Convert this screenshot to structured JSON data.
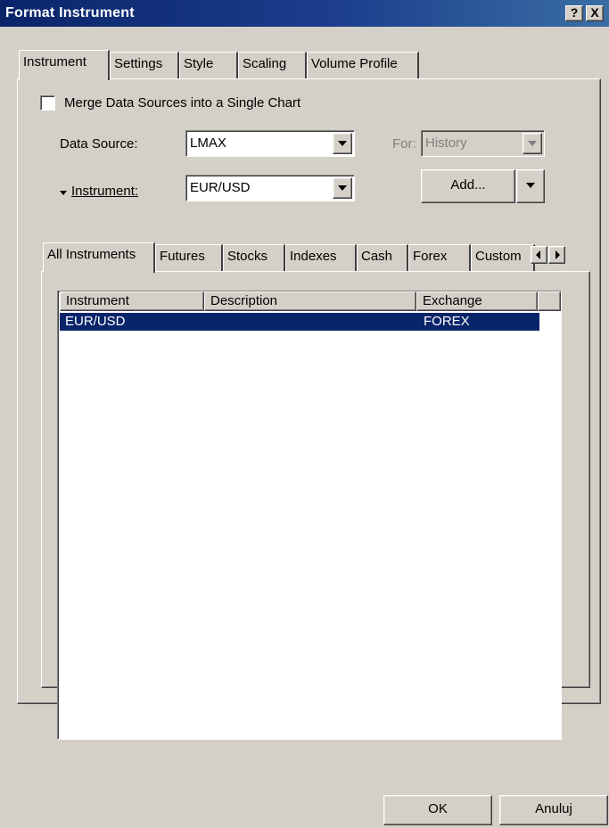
{
  "window": {
    "title": "Format Instrument",
    "help_label": "?",
    "close_label": "X"
  },
  "top_tabs": [
    "Instrument",
    "Settings",
    "Style",
    "Scaling",
    "Volume Profile"
  ],
  "merge": {
    "label": "Merge Data Sources into a Single Chart",
    "checked": false
  },
  "data_source": {
    "label": "Data Source:",
    "value": "LMAX"
  },
  "for": {
    "label": "For:",
    "value": "History"
  },
  "instrument": {
    "label": "Instrument:",
    "value": "EUR/USD"
  },
  "add_button": {
    "label": "Add..."
  },
  "inner_tabs": [
    "All Instruments",
    "Futures",
    "Stocks",
    "Indexes",
    "Cash",
    "Forex",
    "Custom"
  ],
  "table": {
    "columns": [
      "Instrument",
      "Description",
      "Exchange"
    ],
    "rows": [
      {
        "instrument": "EUR/USD",
        "description": "",
        "exchange": "FOREX",
        "selected": true
      }
    ]
  },
  "footer": {
    "ok_label": "OK",
    "cancel_label": "Anuluj"
  },
  "colors": {
    "titlebar": "#0a246a",
    "face": "#d4d0c8",
    "selection": "#0a246a"
  }
}
